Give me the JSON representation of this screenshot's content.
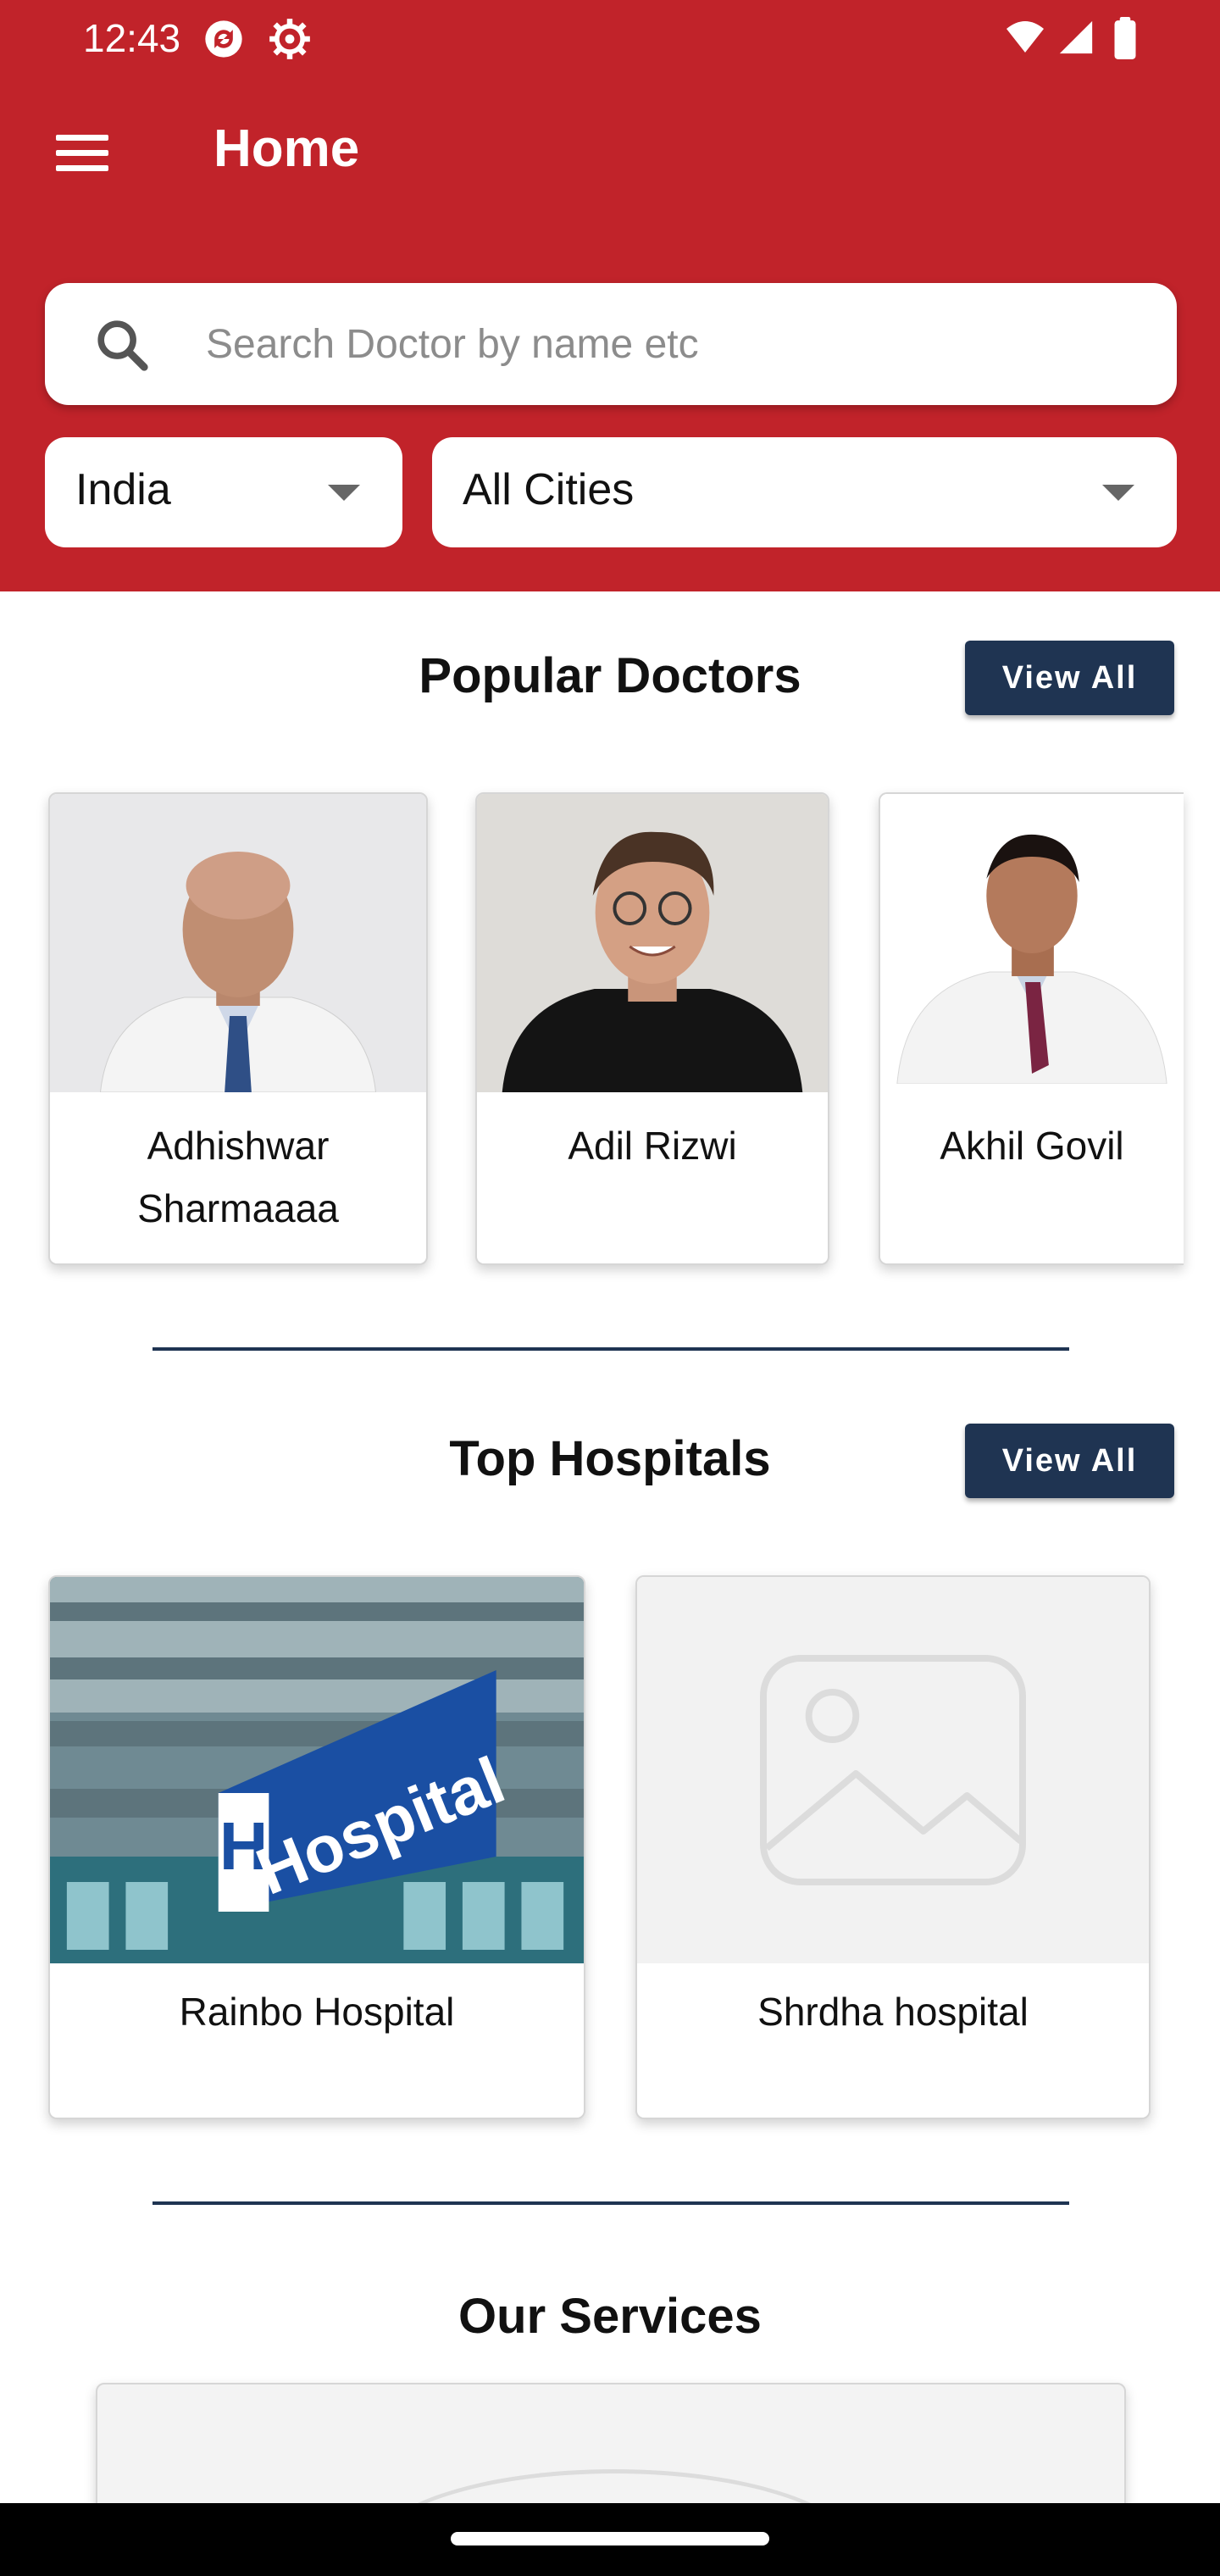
{
  "status_bar": {
    "time": "12:43"
  },
  "header": {
    "title": "Home",
    "color": "#c1232a"
  },
  "search": {
    "placeholder": "Search Doctor by name etc"
  },
  "filters": {
    "country": "India",
    "city": "All Cities"
  },
  "popular_doctors": {
    "title": "Popular Doctors",
    "view_all": "View All",
    "items": [
      {
        "name": "Adhishwar Sharmaaaa"
      },
      {
        "name": "Adil Rizwi"
      },
      {
        "name": "Akhil Govil"
      }
    ]
  },
  "top_hospitals": {
    "title": "Top Hospitals",
    "view_all": "View All",
    "items": [
      {
        "name": "Rainbo Hospital",
        "sign_text": "Hospital"
      },
      {
        "name": "Shrdha hospital"
      }
    ]
  },
  "services": {
    "title": "Our Services"
  },
  "colors": {
    "accent": "#c1232a",
    "button": "#1f3452"
  }
}
